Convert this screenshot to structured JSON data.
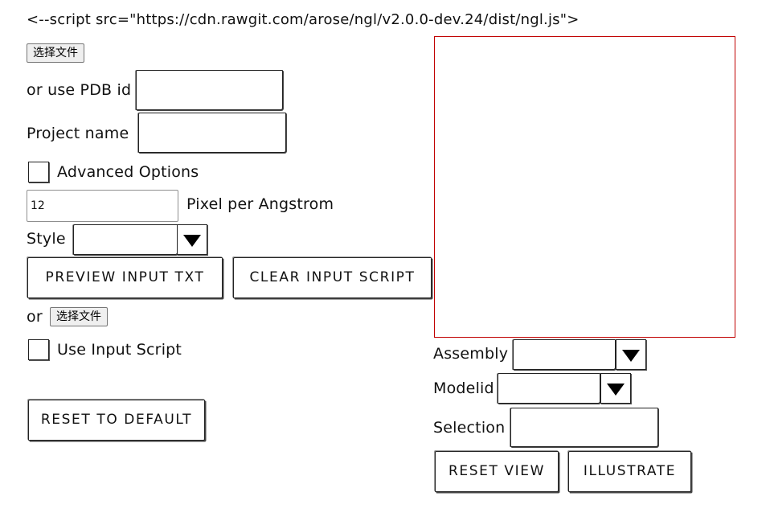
{
  "script_text": "<--script src=\"https://cdn.rawgit.com/arose/ngl/v2.0.0-dev.24/dist/ngl.js\">",
  "file_picker_1": {
    "label": "选择文件"
  },
  "pdb": {
    "label": "or use PDB id",
    "value": ""
  },
  "project": {
    "label": "Project name",
    "value": ""
  },
  "advanced": {
    "label": "Advanced Options",
    "checked": false
  },
  "pixel": {
    "value": "12",
    "label": "Pixel per Angstrom"
  },
  "style": {
    "label": "Style",
    "value": ""
  },
  "buttons": {
    "preview": "PREVIEW INPUT TXT",
    "clear": "CLEAR INPUT SCRIPT",
    "reset_default": "RESET TO DEFAULT",
    "reset_view": "RESET VIEW",
    "illustrate": "ILLUSTRATE"
  },
  "or_text": "or",
  "file_picker_2": {
    "label": "选择文件"
  },
  "use_input": {
    "label": "Use Input Script",
    "checked": false
  },
  "assembly": {
    "label": "Assembly",
    "value": ""
  },
  "modelid": {
    "label": "Modelid",
    "value": ""
  },
  "selection": {
    "label": "Selection",
    "value": ""
  },
  "colors": {
    "viewport_border": "#c00000",
    "ink": "#111111"
  }
}
